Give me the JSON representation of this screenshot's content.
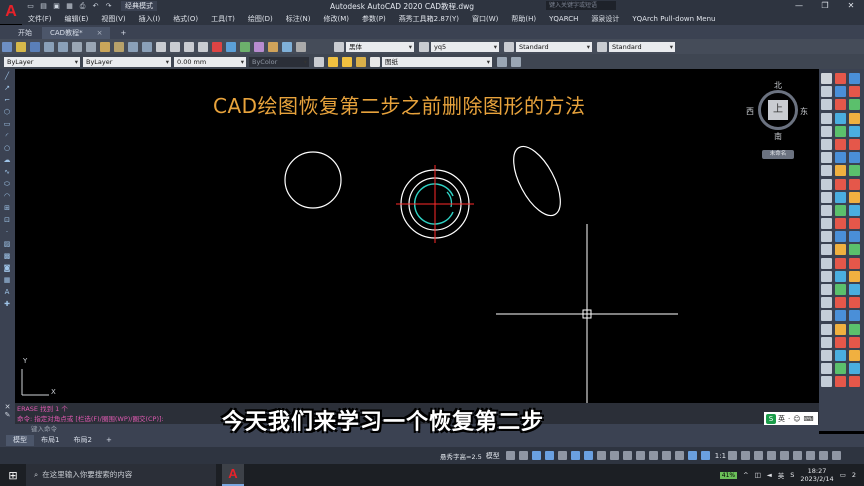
{
  "window": {
    "app_title": "Autodesk AutoCAD 2020   CAD教程.dwg",
    "workspace": "经典模式",
    "search_placeholder": "键入关键字或短语"
  },
  "menu": [
    "文件(F)",
    "编辑(E)",
    "视图(V)",
    "插入(I)",
    "格式(O)",
    "工具(T)",
    "绘图(D)",
    "标注(N)",
    "修改(M)",
    "参数(P)",
    "燕秀工具箱2.87(Y)",
    "窗口(W)",
    "帮助(H)",
    "YQARCH",
    "源泉设计",
    "YQArch Pull-down Menu"
  ],
  "tabs": [
    {
      "label": "开始"
    },
    {
      "label": "CAD教程*"
    }
  ],
  "toolbar1": {
    "text_style": "黑体",
    "dim_style": "yq5",
    "table_style": "Standard",
    "multileader_style": "Standard"
  },
  "toolbar2": {
    "layer": "ByLayer",
    "linetype": "ByLayer",
    "lineweight": "0.00 mm",
    "plotstyle": "ByColor",
    "current_layer": "图纸"
  },
  "canvas": {
    "banner_title": "CAD绘图恢复第二步之前删除图形的方法",
    "viewcube": {
      "top": "上",
      "north": "北",
      "south": "南",
      "west": "西",
      "east": "东",
      "ucs_label": "未命名"
    },
    "ucs_x": "X",
    "ucs_y": "Y"
  },
  "command": {
    "history_line1": "ERASE 找到 1 个",
    "history_line2": "命令: 指定对角点或 [栏选(F)/圈围(WP)/圈交(CP)]:",
    "input_placeholder": "键入命令"
  },
  "subtitle": "今天我们来学习一个恢复第二步",
  "ime": {
    "lang": "英"
  },
  "layout_tabs": [
    "模型",
    "布局1",
    "布局2"
  ],
  "status": {
    "annotation_text": "悬秀字高=2.5",
    "model": "模型",
    "scale": "1:1"
  },
  "taskbar": {
    "search_placeholder": "在这里输入你要搜索的内容",
    "battery": "41%",
    "ime_lang": "英",
    "time": "18:27",
    "date": "2023/2/14",
    "notifications": "2"
  }
}
